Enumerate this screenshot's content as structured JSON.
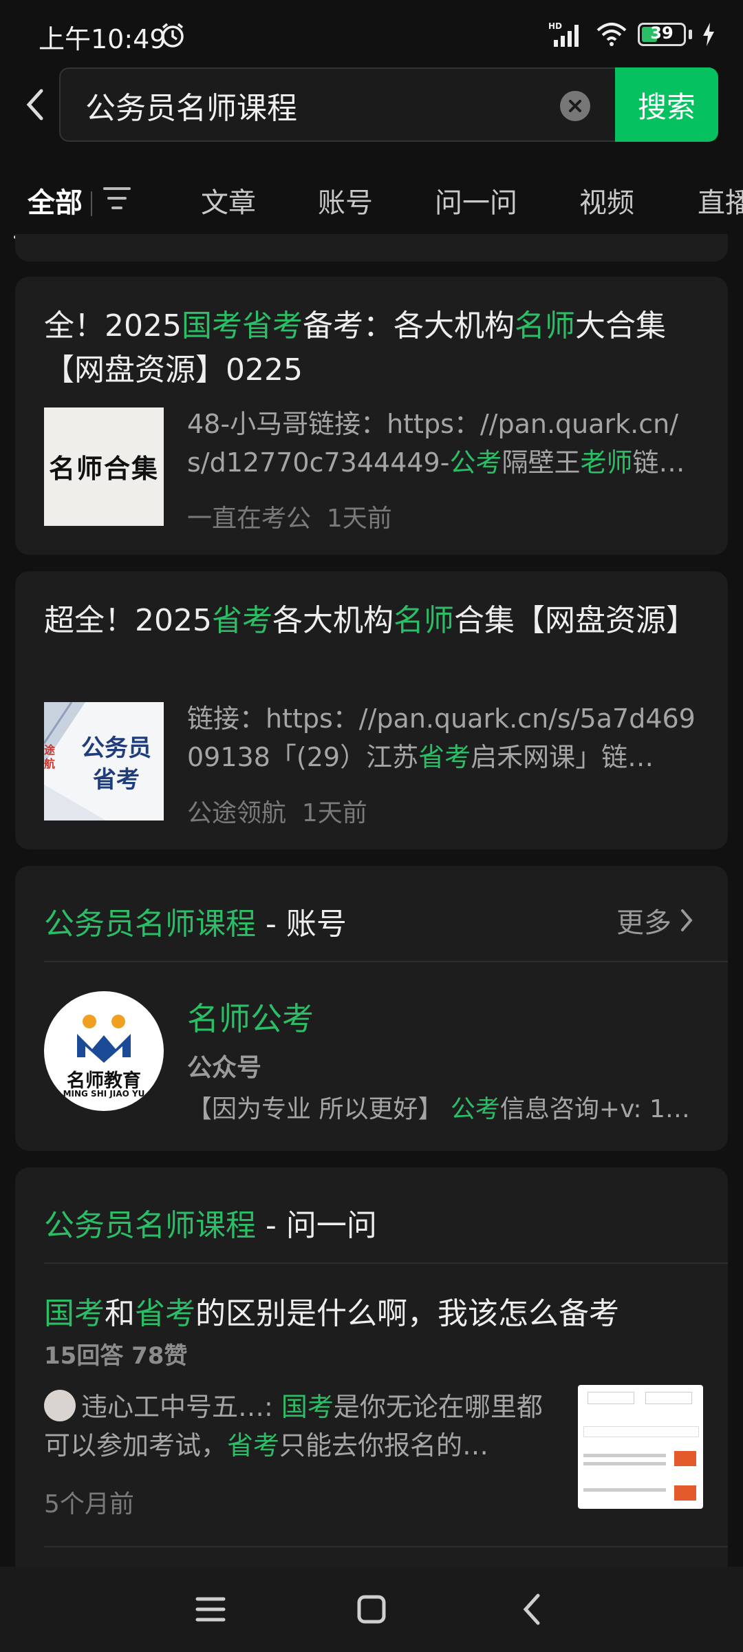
{
  "status": {
    "time": "上午10:49",
    "network": "HD",
    "battery": "39"
  },
  "search": {
    "query": "公务员名师课程",
    "button": "搜索"
  },
  "tabs": [
    "全部",
    "文章",
    "账号",
    "问一问",
    "视频",
    "直播"
  ],
  "articles": [
    {
      "title_parts": [
        "全！2025",
        "国考",
        "省考",
        "备考：各大机构",
        "名师",
        "大合集",
        "【网盘资源】0225"
      ],
      "thumb_text": "名师合集",
      "snippet_parts": [
        "48-小马哥链接：https：//pan.quark.cn/s/d12770c7344449-",
        "公考",
        "隔壁王",
        "老师",
        "链…"
      ],
      "source": "一直在考公",
      "time": "1天前"
    },
    {
      "title_parts": [
        "超全！2025",
        "省考",
        "各大机构",
        "名师",
        "合集【网盘资源】"
      ],
      "thumb_text": "公务员\n省考",
      "thumb_side": "途航",
      "snippet_parts": [
        "链接：https：//pan.quark.cn/s/5a7d46909138「(29）江苏",
        "省考",
        "启禾网课」链…"
      ],
      "source": "公途领航",
      "time": "1天前"
    }
  ],
  "account_section": {
    "title_hl": "公务员名师课程",
    "title_rest": " - 账号",
    "more": "更多",
    "account": {
      "name": "名师公考",
      "type": "公众号",
      "logo_text": "名师教育",
      "logo_sub": "MING SHI JIAO YU",
      "desc_parts": [
        "【因为专业 所以更好】 ",
        "公考",
        "信息咨询+v: 1…"
      ]
    }
  },
  "qa_section": {
    "title_hl": "公务员名师课程",
    "title_rest": " - 问一问",
    "question_parts": [
      "国考",
      "和",
      "省考",
      "的区别是什么啊，我该怎么备考"
    ],
    "stats": "15回答 78赞",
    "answer_parts": [
      "违心工中号五…: ",
      "国考",
      "是你无论在哪里都可以参加考试，",
      "省考",
      "只能去你报名的…"
    ],
    "time": "5个月前",
    "colors": {
      "accent": "#2cbe66",
      "button": "#06c160"
    }
  }
}
